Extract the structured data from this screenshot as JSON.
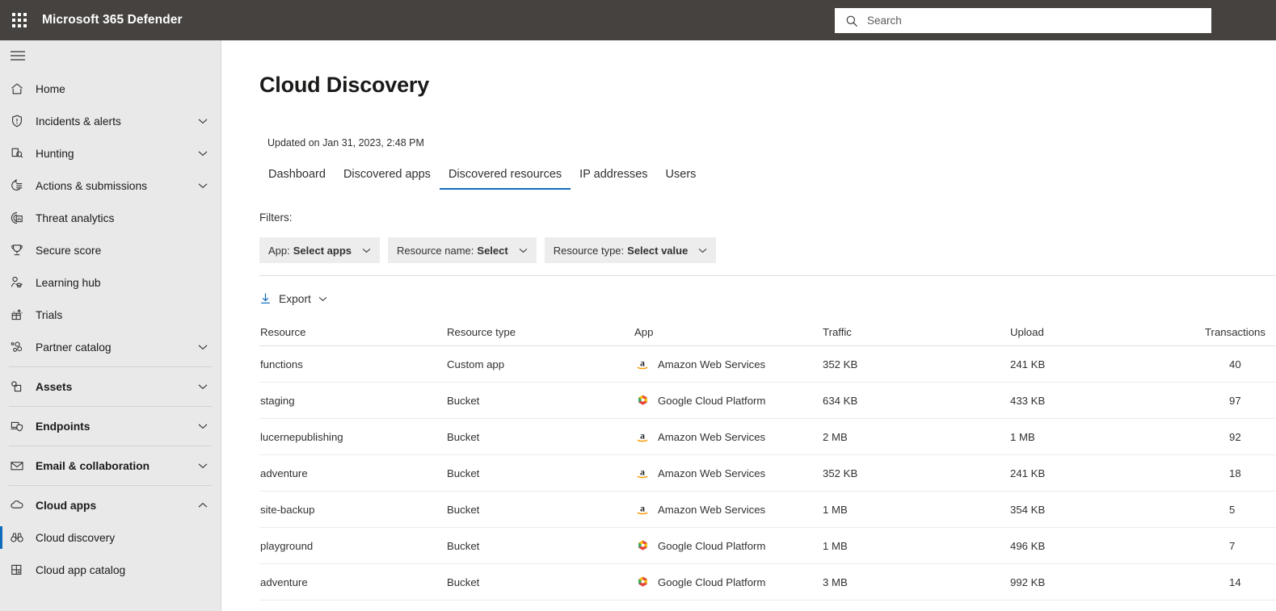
{
  "topbar": {
    "waffle_label": "app-launcher",
    "brand": "Microsoft 365 Defender",
    "search_placeholder": "Search",
    "search_value": "",
    "bg_color": "#45423f"
  },
  "sidebar": {
    "items": [
      {
        "label": "Home",
        "icon": "home-icon",
        "chevron": "",
        "bold": false,
        "selected": false,
        "sub": false
      },
      {
        "label": "Incidents & alerts",
        "icon": "shield-alert-icon",
        "chevron": "down",
        "bold": false,
        "selected": false,
        "sub": false
      },
      {
        "label": "Hunting",
        "icon": "hunting-icon",
        "chevron": "down",
        "bold": false,
        "selected": false,
        "sub": false
      },
      {
        "label": "Actions & submissions",
        "icon": "actions-icon",
        "chevron": "down",
        "bold": false,
        "selected": false,
        "sub": false
      },
      {
        "label": "Threat analytics",
        "icon": "threat-analytics-icon",
        "chevron": "",
        "bold": false,
        "selected": false,
        "sub": false
      },
      {
        "label": "Secure score",
        "icon": "trophy-icon",
        "chevron": "",
        "bold": false,
        "selected": false,
        "sub": false
      },
      {
        "label": "Learning hub",
        "icon": "learning-hub-icon",
        "chevron": "",
        "bold": false,
        "selected": false,
        "sub": false
      },
      {
        "label": "Trials",
        "icon": "trials-gift-icon",
        "chevron": "",
        "bold": false,
        "selected": false,
        "sub": false
      },
      {
        "label": "Partner catalog",
        "icon": "partner-catalog-icon",
        "chevron": "down",
        "bold": false,
        "selected": false,
        "sub": false
      },
      {
        "label": "Assets",
        "icon": "assets-icon",
        "chevron": "down",
        "bold": true,
        "selected": false,
        "sub": false
      },
      {
        "label": "Endpoints",
        "icon": "endpoints-icon",
        "chevron": "down",
        "bold": true,
        "selected": false,
        "sub": false
      },
      {
        "label": "Email & collaboration",
        "icon": "mail-icon",
        "chevron": "down",
        "bold": true,
        "selected": false,
        "sub": false
      },
      {
        "label": "Cloud apps",
        "icon": "cloud-icon",
        "chevron": "up",
        "bold": true,
        "selected": false,
        "sub": false
      },
      {
        "label": "Cloud discovery",
        "icon": "binoculars-icon",
        "chevron": "",
        "bold": false,
        "selected": true,
        "sub": true
      },
      {
        "label": "Cloud app catalog",
        "icon": "catalog-grid-icon",
        "chevron": "",
        "bold": false,
        "selected": false,
        "sub": true
      }
    ],
    "accent_color": "#0f6cbd",
    "bg_color": "#e9e9e9"
  },
  "page": {
    "title": "Cloud Discovery",
    "updated": "Updated on Jan 31, 2023, 2:48 PM"
  },
  "tabs": [
    {
      "label": "Dashboard",
      "active": false
    },
    {
      "label": "Discovered apps",
      "active": false
    },
    {
      "label": "Discovered resources",
      "active": true
    },
    {
      "label": "IP addresses",
      "active": false
    },
    {
      "label": "Users",
      "active": false
    }
  ],
  "filters": {
    "label": "Filters:",
    "pills": [
      {
        "key": "App:",
        "value": "Select apps"
      },
      {
        "key": "Resource name:",
        "value": "Select"
      },
      {
        "key": "Resource type:",
        "value": "Select value"
      }
    ]
  },
  "toolbar": {
    "export_label": "Export",
    "export_icon": "download-icon",
    "export_chevron": "chevron-down-icon"
  },
  "table": {
    "columns": [
      "Resource",
      "Resource type",
      "App",
      "Traffic",
      "Upload",
      "Transactions"
    ],
    "rows": [
      {
        "resource": "functions",
        "type": "Custom app",
        "app": "Amazon Web Services",
        "app_icon": "aws-icon",
        "traffic": "352 KB",
        "upload": "241 KB",
        "transactions": "40"
      },
      {
        "resource": "staging",
        "type": "Bucket",
        "app": "Google Cloud Platform",
        "app_icon": "gcp-icon",
        "traffic": "634 KB",
        "upload": "433 KB",
        "transactions": "97"
      },
      {
        "resource": "lucernepublishing",
        "type": "Bucket",
        "app": "Amazon Web Services",
        "app_icon": "aws-icon",
        "traffic": "2 MB",
        "upload": "1 MB",
        "transactions": "92"
      },
      {
        "resource": "adventure",
        "type": "Bucket",
        "app": "Amazon Web Services",
        "app_icon": "aws-icon",
        "traffic": "352 KB",
        "upload": "241 KB",
        "transactions": "18"
      },
      {
        "resource": "site-backup",
        "type": "Bucket",
        "app": "Amazon Web Services",
        "app_icon": "aws-icon",
        "traffic": "1 MB",
        "upload": "354 KB",
        "transactions": "5"
      },
      {
        "resource": "playground",
        "type": "Bucket",
        "app": "Google Cloud Platform",
        "app_icon": "gcp-icon",
        "traffic": "1 MB",
        "upload": "496 KB",
        "transactions": "7"
      },
      {
        "resource": "adventure",
        "type": "Bucket",
        "app": "Google Cloud Platform",
        "app_icon": "gcp-icon",
        "traffic": "3 MB",
        "upload": "992 KB",
        "transactions": "14"
      }
    ]
  },
  "colors": {
    "accent": "#0f6cbd",
    "topbar_bg": "#45423f",
    "sidebar_bg": "#e9e9e9",
    "aws_orange": "#ff9900",
    "gcp_red": "#ea4335",
    "gcp_blue": "#4285f4",
    "gcp_yellow": "#fbbc05",
    "gcp_green": "#34a853"
  }
}
